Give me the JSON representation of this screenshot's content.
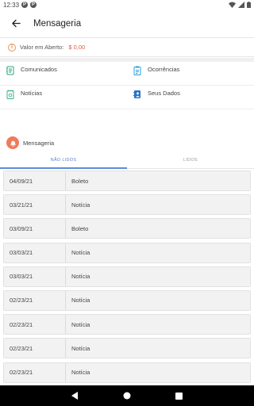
{
  "status_bar": {
    "time": "12:33",
    "notif_icons": [
      "P",
      "P"
    ]
  },
  "app_bar": {
    "title": "Mensageria"
  },
  "balance": {
    "label": "Valor em Aberto:",
    "amount": "$ 0,00"
  },
  "menu": {
    "items": [
      {
        "label": "Comunicados",
        "icon": "megaphone-icon",
        "color": "#2fa37a"
      },
      {
        "label": "Ocorrências",
        "icon": "clipboard-icon",
        "color": "#2b9fd6"
      },
      {
        "label": "Notícias",
        "icon": "notebook-icon",
        "color": "#3bb08a"
      },
      {
        "label": "Seus Dados",
        "icon": "contacts-icon",
        "color": "#2b74c8"
      }
    ]
  },
  "section": {
    "title": "Mensageria"
  },
  "tabs": {
    "unread": "NÃO LIDOS",
    "read": "LIDOS"
  },
  "messages": [
    {
      "date": "04/09/21",
      "type": "Boleto"
    },
    {
      "date": "03/21/21",
      "type": "Notícia"
    },
    {
      "date": "03/09/21",
      "type": "Boleto"
    },
    {
      "date": "03/03/21",
      "type": "Notícia"
    },
    {
      "date": "03/03/21",
      "type": "Notícia"
    },
    {
      "date": "02/23/21",
      "type": "Notícia"
    },
    {
      "date": "02/23/21",
      "type": "Notícia"
    },
    {
      "date": "02/23/21",
      "type": "Notícia"
    },
    {
      "date": "02/23/21",
      "type": "Notícia"
    }
  ]
}
